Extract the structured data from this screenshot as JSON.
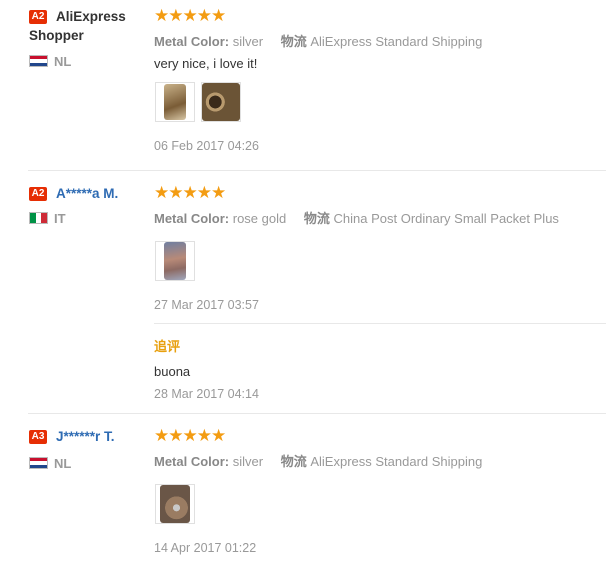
{
  "reviews": [
    {
      "level": "A2",
      "name_line1": "AliExpress",
      "name_line2": "Shopper",
      "country": "NL",
      "stars": "★★★★★",
      "attr_label": "Metal Color:",
      "attr_value": "silver",
      "ship_label": "物流",
      "ship_value": "AliExpress Standard Shipping",
      "text": "very nice, i love it!",
      "date": "06 Feb 2017 04:26"
    },
    {
      "level": "A2",
      "name": "A*****a M.",
      "country": "IT",
      "stars": "★★★★★",
      "attr_label": "Metal Color:",
      "attr_value": "rose gold",
      "ship_label": "物流",
      "ship_value": "China Post Ordinary Small Packet Plus",
      "date": "27 Mar 2017 03:57",
      "followup_label": "追评",
      "followup_text": "buona",
      "followup_date": "28 Mar 2017 04:14"
    },
    {
      "level": "A3",
      "name": "J******r T.",
      "country": "NL",
      "stars": "★★★★★",
      "attr_label": "Metal Color:",
      "attr_value": "silver",
      "ship_label": "物流",
      "ship_value": "AliExpress Standard Shipping",
      "date": "14 Apr 2017 01:22"
    }
  ],
  "colors": {
    "badge": "#e62e04",
    "star": "#f39c12",
    "link": "#2e6bb3",
    "followup": "#e8a00f"
  }
}
